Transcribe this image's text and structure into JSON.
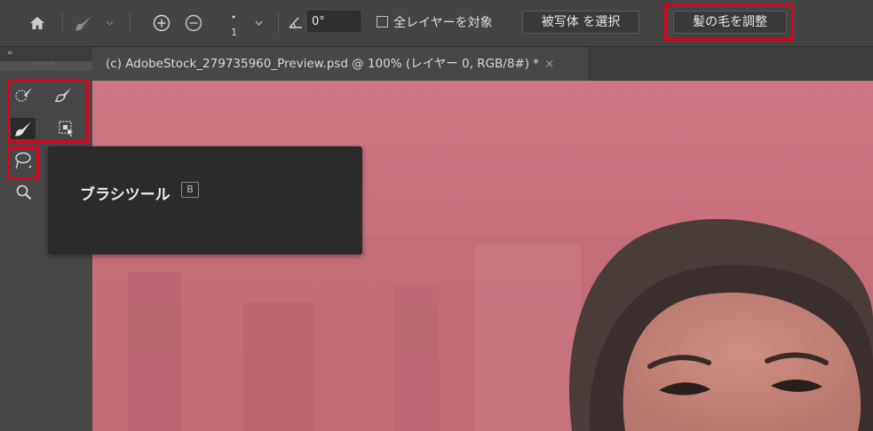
{
  "options_bar": {
    "brush_size": "1",
    "angle_value": "0°",
    "sample_all_layers_label": "全レイヤーを対象",
    "sample_all_layers_checked": false,
    "select_subject_label": "被写体 を選択",
    "refine_hair_label": "髪の毛を調整"
  },
  "toolbar": {
    "collapse_label": "‹‹",
    "tools": [
      {
        "name": "quick-selection",
        "icon": "quick-selection-icon"
      },
      {
        "name": "object-brush",
        "icon": "brush-alt-icon"
      },
      {
        "name": "brush",
        "icon": "brush-icon",
        "selected": true
      },
      {
        "name": "object-selection",
        "icon": "object-selection-icon"
      },
      {
        "name": "lasso",
        "icon": "lasso-icon"
      },
      {
        "name": "zoom",
        "icon": "magnifier-icon"
      }
    ]
  },
  "document": {
    "tab_title": "(c) AdobeStock_279735960_Preview.psd @ 100% (レイヤー 0, RGB/8#) *",
    "close_glyph": "×"
  },
  "tooltip": {
    "title": "ブラシツール",
    "shortcut": "B"
  },
  "colors": {
    "highlight": "#e0001a",
    "canvas_overlay": "#c8727d",
    "panel": "#444444"
  }
}
